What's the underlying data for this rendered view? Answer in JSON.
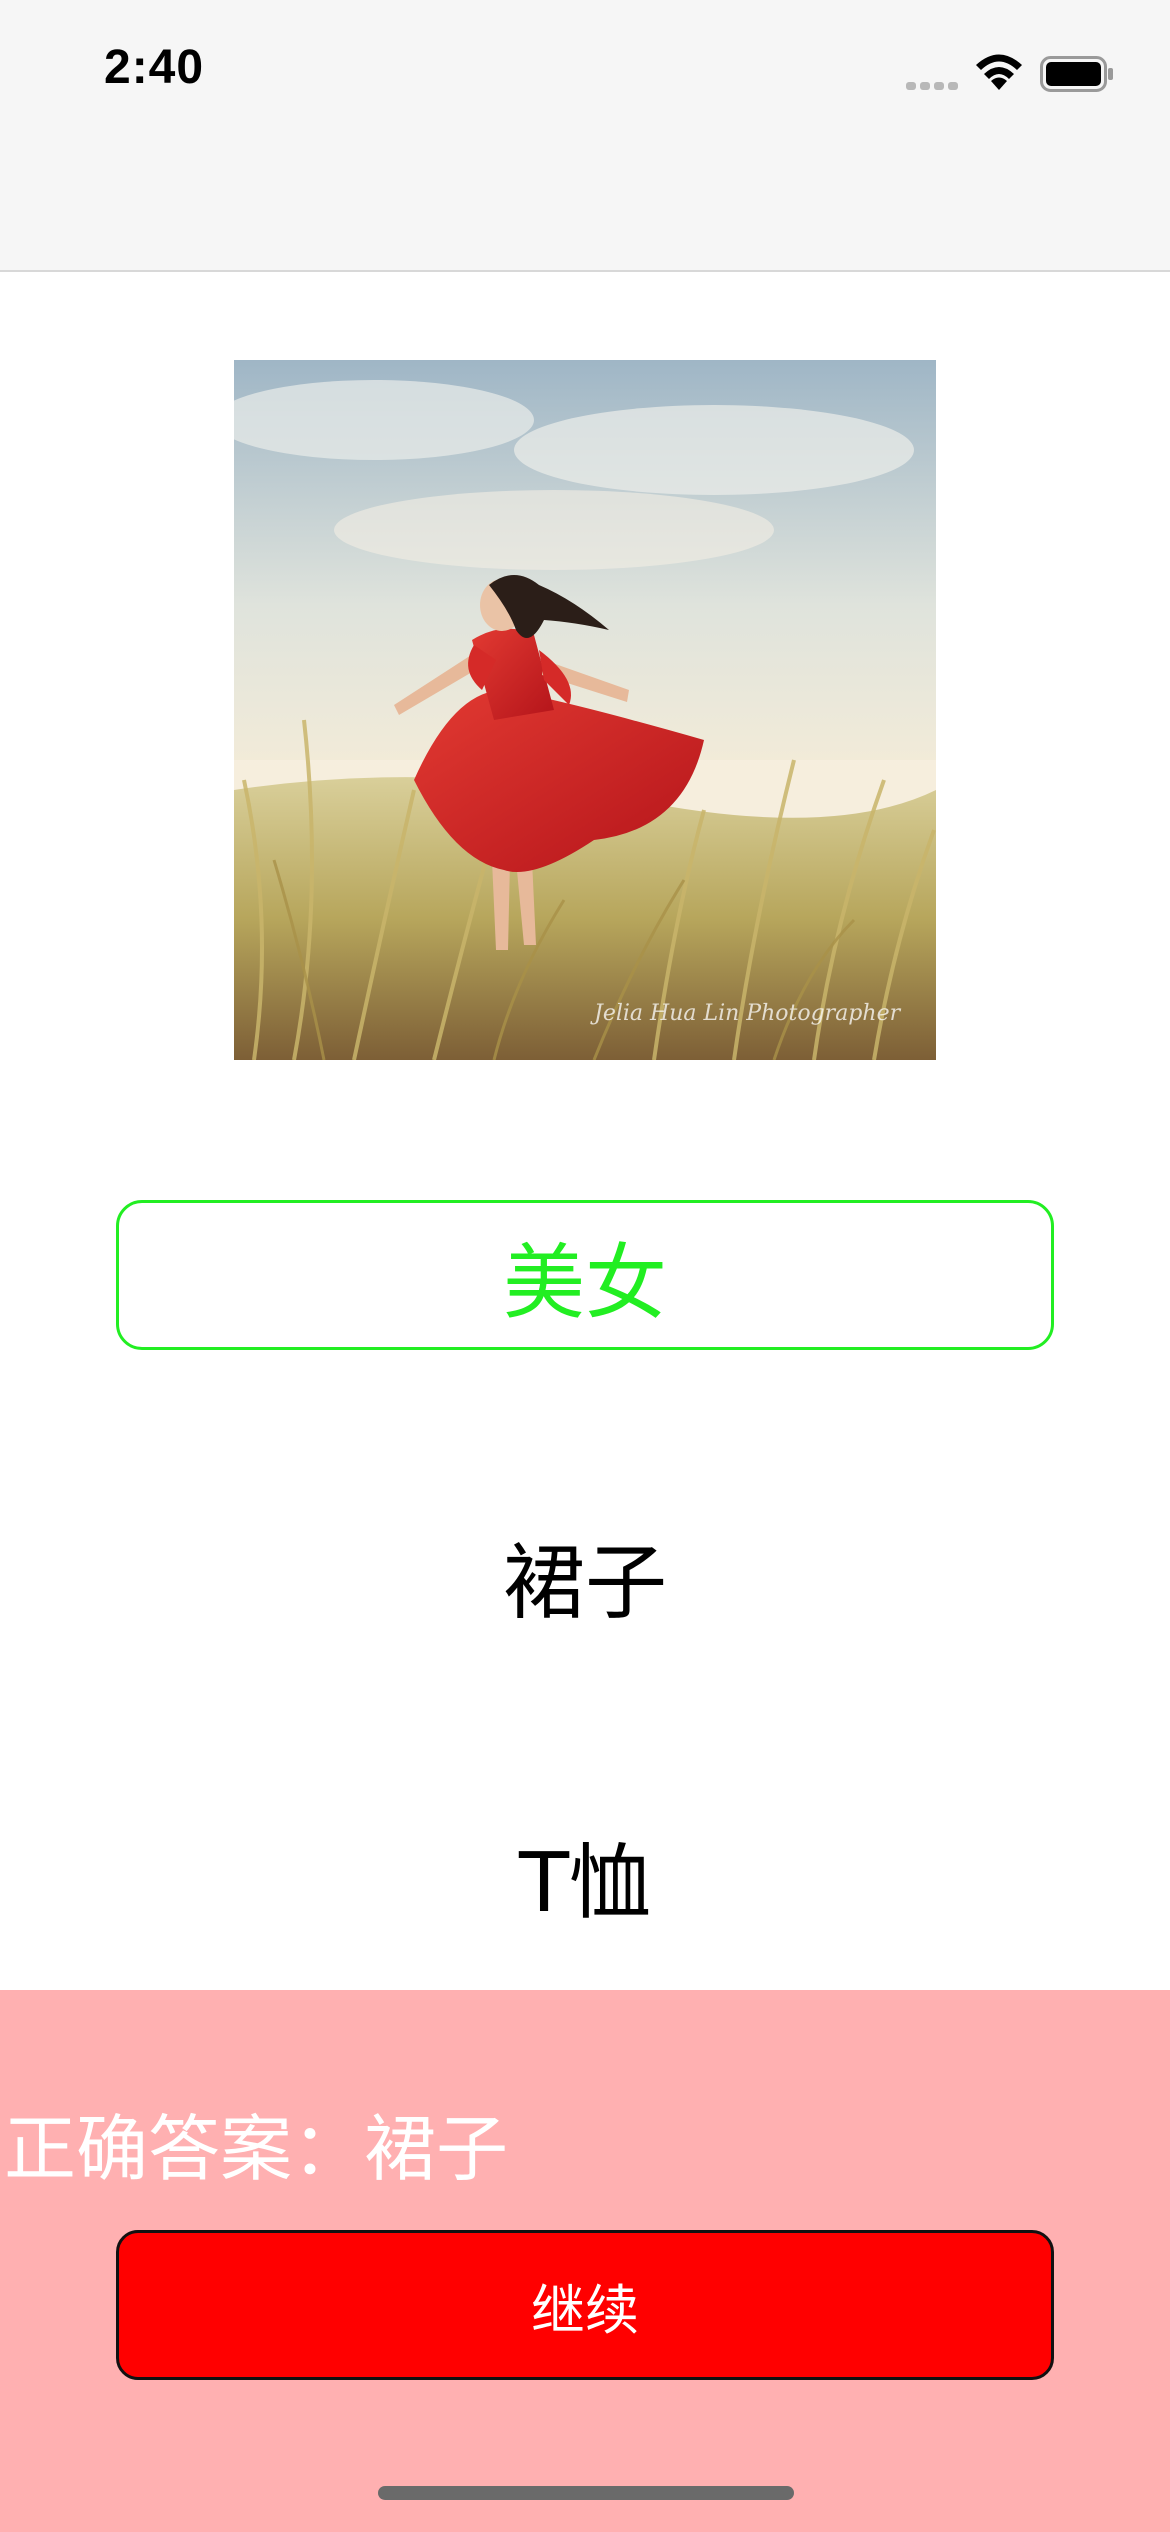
{
  "status_bar": {
    "time": "2:40",
    "icons": [
      "cellular-signal-icon",
      "wifi-icon",
      "battery-icon"
    ]
  },
  "content": {
    "image": "photo-woman-red-dress-in-field",
    "image_watermark": "Jelia Hua Lin Photographer"
  },
  "options": [
    {
      "label": "美女",
      "selected": true
    },
    {
      "label": "裙子",
      "selected": false
    },
    {
      "label": "T恤",
      "selected": false
    }
  ],
  "feedback": {
    "answer_text": "正确答案：裙子",
    "continue_label": "继续"
  },
  "colors": {
    "selected_option": "#22ee22",
    "feedback_background": "#ffb0b1",
    "continue_button": "#ff0000",
    "header_background": "#f6f6f6"
  }
}
